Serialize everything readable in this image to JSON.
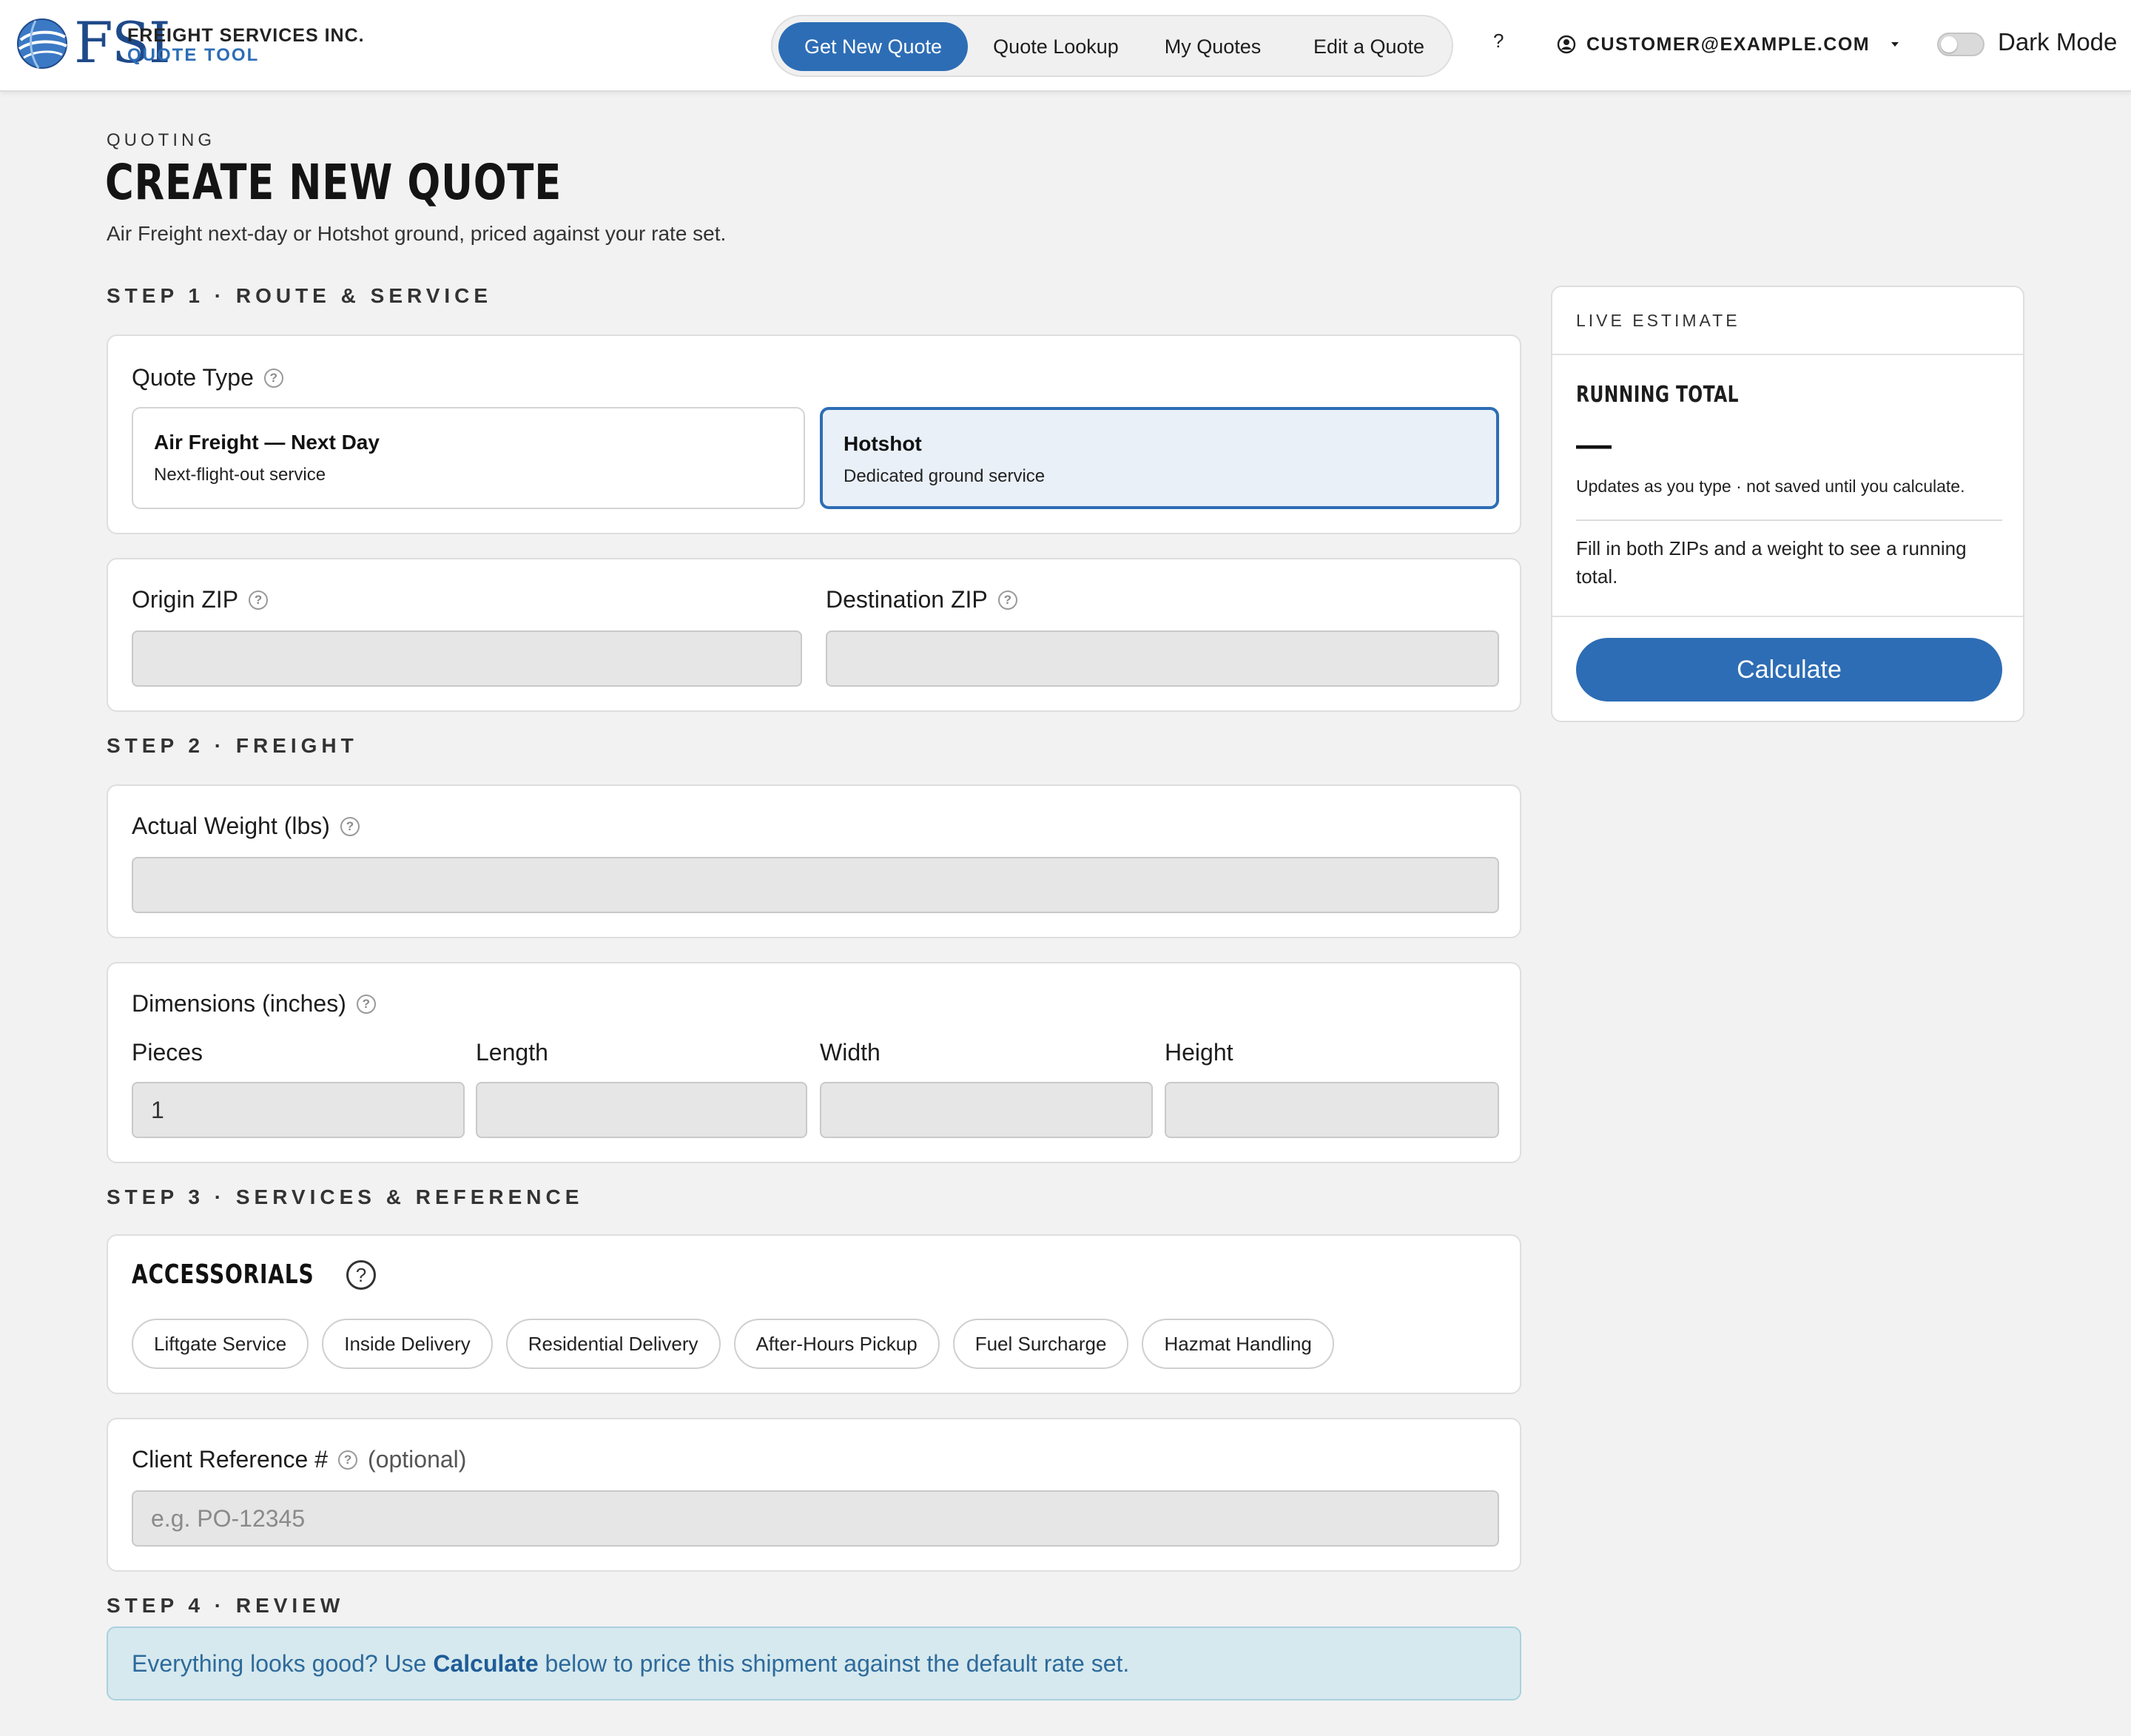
{
  "brand": {
    "logo_text": "FSI",
    "company": "FREIGHT SERVICES INC.",
    "app": "QUOTE TOOL"
  },
  "nav": {
    "items": [
      {
        "label": "Get New Quote",
        "active": true
      },
      {
        "label": "Quote Lookup",
        "active": false
      },
      {
        "label": "My Quotes",
        "active": false
      },
      {
        "label": "Edit a Quote",
        "active": false
      }
    ],
    "help": "?",
    "account_email": "CUSTOMER@EXAMPLE.COM",
    "dark_mode_label": "Dark Mode",
    "dark_mode_on": false
  },
  "page": {
    "eyebrow": "QUOTING",
    "title": "CREATE NEW QUOTE",
    "subtitle": "Air Freight next-day or Hotshot ground, priced against your rate set."
  },
  "step1": {
    "heading": "STEP 1 · ROUTE & SERVICE",
    "quote_type_label": "Quote Type",
    "options": [
      {
        "title": "Air Freight — Next Day",
        "desc": "Next-flight-out service",
        "selected": false
      },
      {
        "title": "Hotshot",
        "desc": "Dedicated ground service",
        "selected": true
      }
    ],
    "origin_label": "Origin ZIP",
    "origin_value": "",
    "destination_label": "Destination ZIP",
    "destination_value": ""
  },
  "step2": {
    "heading": "STEP 2 · FREIGHT",
    "weight_label": "Actual Weight (lbs)",
    "weight_value": "",
    "dimensions_label": "Dimensions (inches)",
    "pieces_label": "Pieces",
    "pieces_value": "1",
    "length_label": "Length",
    "width_label": "Width",
    "height_label": "Height"
  },
  "step3": {
    "heading": "STEP 3 · SERVICES & REFERENCE",
    "accessorials_title": "ACCESSORIALS",
    "accessorials": [
      "Liftgate Service",
      "Inside Delivery",
      "Residential Delivery",
      "After-Hours Pickup",
      "Fuel Surcharge",
      "Hazmat Handling"
    ],
    "client_ref_label": "Client Reference #",
    "client_ref_optional": "(optional)",
    "client_ref_placeholder": "e.g. PO-12345"
  },
  "step4": {
    "heading": "STEP 4 · REVIEW",
    "banner_prefix": "Everything looks good? Use ",
    "banner_bold": "Calculate",
    "banner_suffix": " below to price this shipment against the default rate set."
  },
  "estimate": {
    "heading": "LIVE ESTIMATE",
    "running_total_label": "RUNNING TOTAL",
    "running_total_value": "—",
    "note": "Updates as you type · not saved until you calculate.",
    "hint": "Fill in both ZIPs and a weight to see a running total.",
    "calculate_label": "Calculate"
  },
  "colors": {
    "accent": "#2d6db5",
    "selected_bg": "#e9f0f8",
    "banner_bg": "#d6e9ef",
    "banner_text": "#2e6a9a"
  }
}
